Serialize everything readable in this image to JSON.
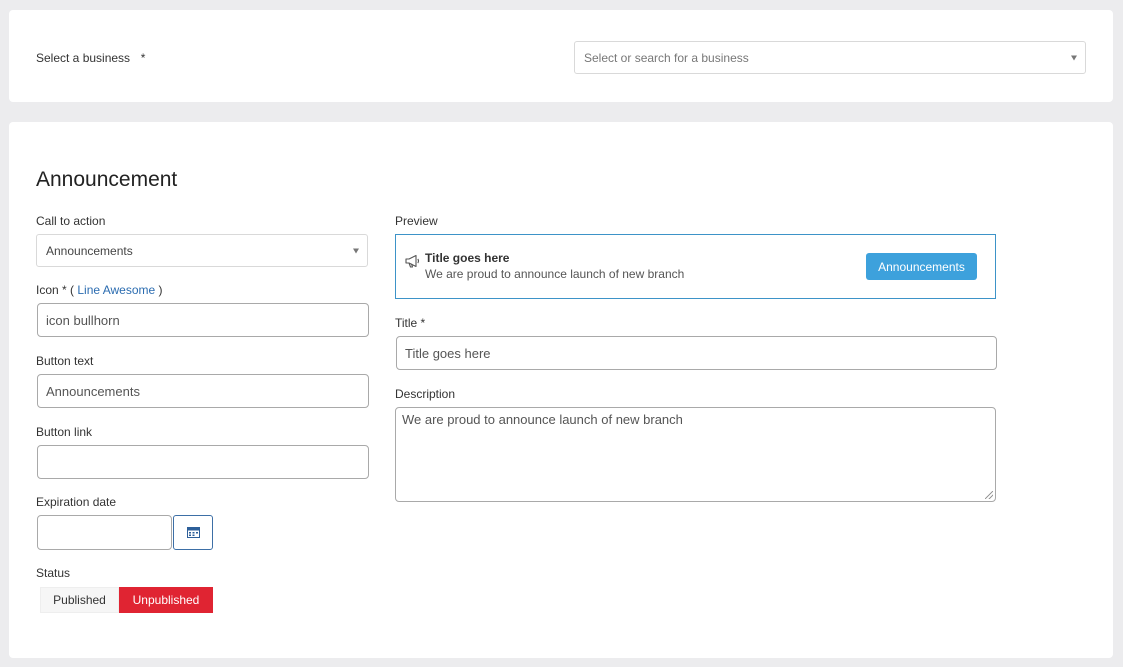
{
  "business": {
    "label": "Select a business",
    "required_mark": "*",
    "placeholder": "Select or search for a business"
  },
  "announcement": {
    "heading": "Announcement",
    "call_to_action": {
      "label": "Call to action",
      "value": "Announcements"
    },
    "icon": {
      "label_prefix": "Icon * (",
      "label_link": "Line Awesome",
      "label_suffix": ")",
      "value": "icon bullhorn",
      "icon_name": "bullhorn-icon"
    },
    "button_text": {
      "label": "Button text",
      "value": "Announcements"
    },
    "button_link": {
      "label": "Button link",
      "value": ""
    },
    "expiration_date": {
      "label": "Expiration date",
      "value": "",
      "icon_name": "calendar-icon"
    },
    "status": {
      "label": "Status",
      "options": [
        "Published",
        "Unpublished"
      ],
      "selected": "Unpublished"
    },
    "preview": {
      "label": "Preview",
      "title": "Title goes here",
      "description": "We are proud to announce launch of new branch",
      "button_label": "Announcements"
    },
    "title": {
      "label": "Title *",
      "value": "Title goes here"
    },
    "description": {
      "label": "Description",
      "value": "We are proud to announce launch of new branch"
    }
  },
  "colors": {
    "accent": "#3da1dc",
    "unpublished": "#e02432",
    "preview_border": "#3d93c8"
  }
}
